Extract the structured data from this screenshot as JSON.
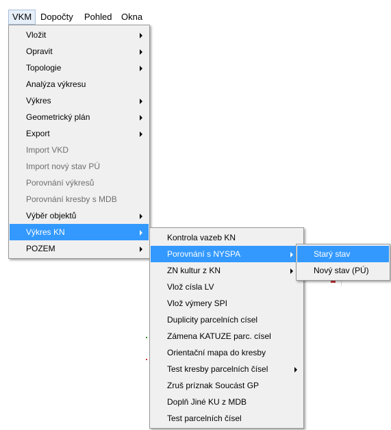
{
  "menubar": {
    "items": [
      "VKM",
      "Dopočty",
      "Pohled",
      "Okna"
    ]
  },
  "menu_vkm": {
    "items": [
      "Vložit",
      "Opravit",
      "Topologie",
      "Analýza výkresu",
      "Výkres",
      "Geometrický plán",
      "Export",
      "Import VKD",
      "Import nový stav PÚ",
      "Porovnání výkresů",
      "Porovnání  kresby s MDB",
      "Výběr objektů",
      "Výkres KN",
      "POZEM"
    ]
  },
  "menu_vykres_kn": {
    "items": [
      "Kontrola vazeb KN",
      "Porovnání s NYSPA",
      "ZN kultur z KN",
      "Vlož císla LV",
      "Vlož výmery SPI",
      "Duplicity parcelních císel",
      "Zámena KATUZE parc. císel",
      "Orientační mapa do kresby",
      "Test kresby parcelních čísel",
      "Zruš príznak Soucást GP",
      "Doplň Jiné KU z MDB",
      "Test parcelních čísel"
    ]
  },
  "menu_nyspa": {
    "items": [
      "Starý stav",
      "Nový stav  (PÚ)"
    ]
  },
  "colors": {
    "highlight": "#3399ff",
    "menu_bg": "#f0f0f0",
    "disabled_text": "#6d6d6d"
  }
}
